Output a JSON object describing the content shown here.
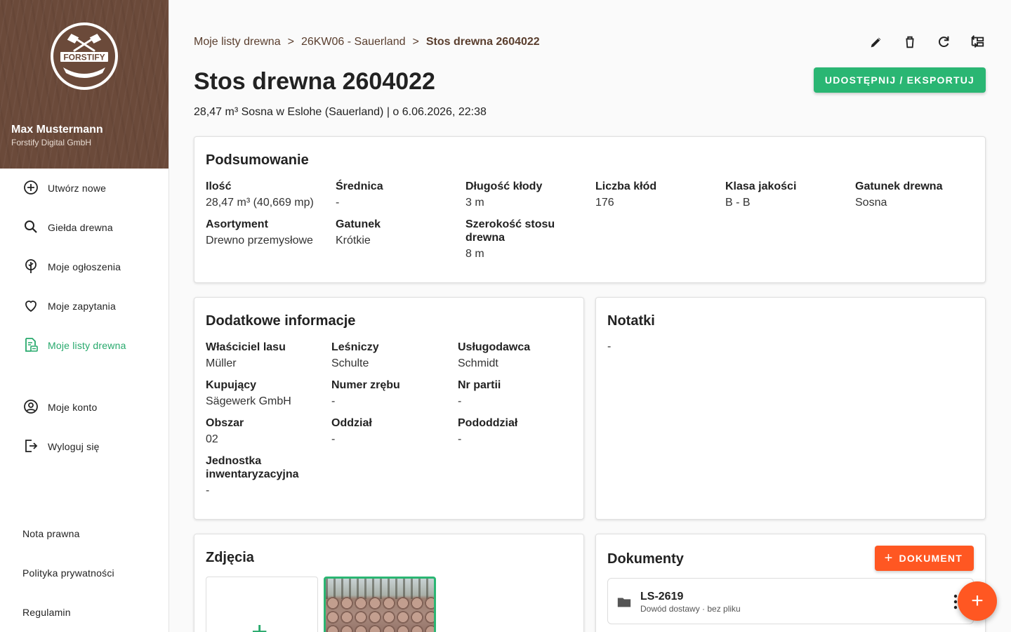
{
  "sidebar": {
    "logo_text": "FORSTIFY",
    "user_name": "Max Mustermann",
    "user_company": "Forstify Digital GmbH",
    "nav": [
      {
        "label": "Utwórz nowe",
        "icon": "plus-circle-icon"
      },
      {
        "label": "Giełda drewna",
        "icon": "search-icon"
      },
      {
        "label": "Moje ogłoszenia",
        "icon": "tree-icon"
      },
      {
        "label": "Moje zapytania",
        "icon": "heart-icon"
      },
      {
        "label": "Moje listy drewna",
        "icon": "list-document-icon",
        "active": true
      },
      {
        "label": "Moje konto",
        "icon": "account-circle-icon"
      },
      {
        "label": "Wyloguj się",
        "icon": "logout-icon"
      }
    ],
    "footer": [
      "Nota prawna",
      "Polityka prywatności",
      "Regulamin"
    ]
  },
  "breadcrumb": [
    "Moje listy drewna",
    "26KW06 - Sauerland",
    "Stos drewna 2604022"
  ],
  "breadcrumb_sep": ">",
  "title": "Stos drewna 2604022",
  "subtitle": "28,47 m³ Sosna w Eslohe (Sauerland) | o 6.06.2026, 22:38",
  "share_button": "UDOSTĘPNIJ / EKSPORTUJ",
  "toolbar": [
    "edit-icon",
    "delete-icon",
    "refresh-icon",
    "transfer-icon"
  ],
  "summary": {
    "title": "Podsumowanie",
    "fields": [
      {
        "key": "Ilość",
        "value": "28,47 m³ (40,669 mp)"
      },
      {
        "key": "Średnica",
        "value": "-"
      },
      {
        "key": "Długość kłody",
        "value": "3 m"
      },
      {
        "key": "Liczba kłód",
        "value": "176"
      },
      {
        "key": "Klasa jakości",
        "value": "B - B"
      },
      {
        "key": "Gatunek drewna",
        "value": "Sosna"
      },
      {
        "key": "Asortyment",
        "value": "Drewno przemysłowe"
      },
      {
        "key": "Gatunek",
        "value": "Krótkie"
      },
      {
        "key": "Szerokość stosu drewna",
        "value": "8 m"
      }
    ]
  },
  "additional": {
    "title": "Dodatkowe informacje",
    "fields": [
      {
        "key": "Właściciel lasu",
        "value": "Müller"
      },
      {
        "key": "Leśniczy",
        "value": "Schulte"
      },
      {
        "key": "Usługodawca",
        "value": "Schmidt"
      },
      {
        "key": "Kupujący",
        "value": "Sägewerk GmbH"
      },
      {
        "key": "Numer zrębu",
        "value": "-"
      },
      {
        "key": "Nr partii",
        "value": "-"
      },
      {
        "key": "Obszar",
        "value": "02"
      },
      {
        "key": "Oddział",
        "value": "-"
      },
      {
        "key": "Pododdział",
        "value": "-"
      },
      {
        "key": "Jednostka inwentaryzacyjna",
        "value": "-"
      }
    ]
  },
  "notes": {
    "title": "Notatki",
    "value": "-"
  },
  "photos": {
    "title": "Zdjęcia",
    "add_symbol": "+"
  },
  "documents": {
    "title": "Dokumenty",
    "add_button": "DOKUMENT",
    "add_symbol": "+",
    "items": [
      {
        "name": "LS-2619",
        "meta": "Dowód dostawy · bez pliku"
      }
    ]
  },
  "fab_symbol": "+",
  "colors": {
    "brand_brown": "#6b4a3a",
    "accent_green": "#2ab673",
    "accent_orange": "#ff5722"
  }
}
